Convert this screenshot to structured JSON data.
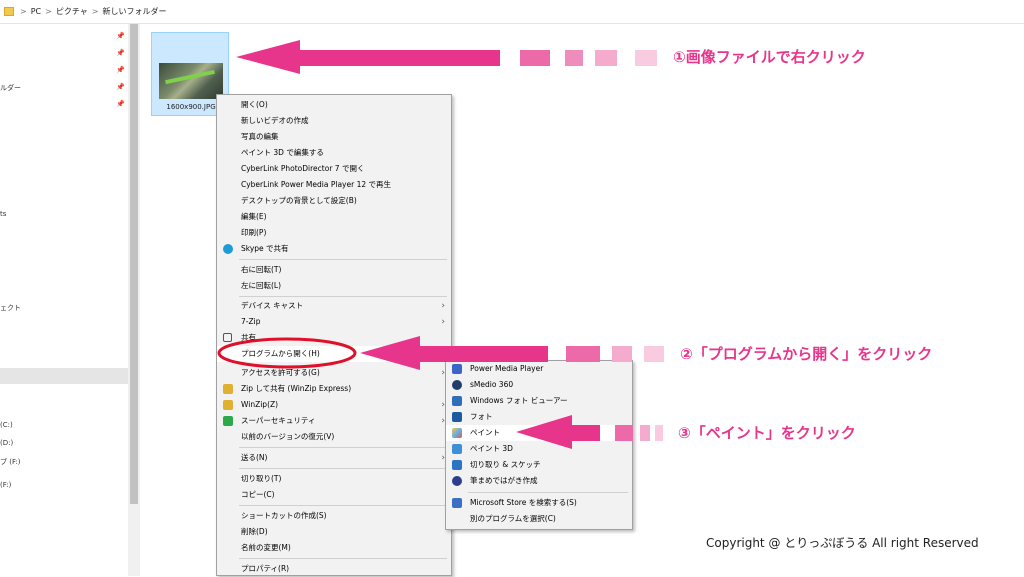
{
  "address": {
    "crumbs": [
      "PC",
      "ピクチャ",
      "新しいフォルダー"
    ],
    "separator": ">"
  },
  "nav": {
    "items": [
      {
        "label": "ルダー"
      },
      {
        "label": "ts"
      },
      {
        "label": "ェクト"
      },
      {
        "label": "(C:)"
      },
      {
        "label": "(D:)"
      },
      {
        "label": "ブ (F:)"
      },
      {
        "label": "(F:)"
      }
    ],
    "pin_glyph": "📌"
  },
  "file": {
    "name": "1600x900.JPG"
  },
  "context_menu": {
    "items": [
      "開く(O)",
      "新しいビデオの作成",
      "写真の編集",
      "ペイント 3D で編集する",
      "CyberLink PhotoDirector 7 で開く",
      "CyberLink Power Media Player 12 で再生",
      "デスクトップの背景として設定(B)",
      "編集(E)",
      "印刷(P)",
      "Skype で共有",
      "右に回転(T)",
      "左に回転(L)",
      "デバイス キャスト",
      "7-Zip",
      "共有",
      "プログラムから開く(H)",
      "アクセスを許可する(G)",
      "Zip して共有 (WinZip Express)",
      "WinZip(Z)",
      "スーパーセキュリティ",
      "以前のバージョンの復元(V)",
      "送る(N)",
      "切り取り(T)",
      "コピー(C)",
      "ショートカットの作成(S)",
      "削除(D)",
      "名前の変更(M)",
      "プロパティ(R)"
    ]
  },
  "open_with_menu": {
    "items": [
      "Power Media Player",
      "sMedio 360",
      "Windows フォト ビューアー",
      "フォト",
      "ペイント",
      "ペイント 3D",
      "切り取り & スケッチ",
      "筆まめではがき作成",
      "Microsoft Store を検索する(S)",
      "別のプログラムを選択(C)"
    ]
  },
  "annotations": {
    "step1": "①画像ファイルで右クリック",
    "step2": "②「プログラムから開く」をクリック",
    "step3": "③「ペイント」をクリック",
    "copyright": "Copyright @ とりっぷぼうる All right Reserved"
  },
  "colors": {
    "accent": "#e8358c",
    "selection": "#cce8ff",
    "circle": "#e0102a"
  }
}
